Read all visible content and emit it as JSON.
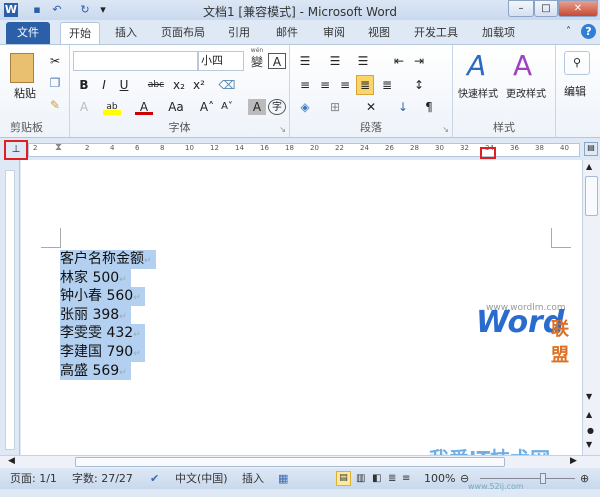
{
  "window": {
    "title": "文档1 [兼容模式] - Microsoft Word",
    "app_icon": "W"
  },
  "tabs": [
    {
      "label": "文件"
    },
    {
      "label": "开始"
    },
    {
      "label": "插入"
    },
    {
      "label": "页面布局"
    },
    {
      "label": "引用"
    },
    {
      "label": "邮件"
    },
    {
      "label": "审阅"
    },
    {
      "label": "视图"
    },
    {
      "label": "开发工具"
    },
    {
      "label": "加载项"
    }
  ],
  "ribbon": {
    "clipboard": {
      "label": "剪贴板",
      "paste": "粘贴"
    },
    "font": {
      "label": "字体",
      "font_name": "",
      "font_size": "小四",
      "bold": "B",
      "italic": "I",
      "underline": "U",
      "strike": "abc",
      "sub": "x₂",
      "sup": "x²",
      "font_color": "A",
      "case": "Aa",
      "grow": "A˄",
      "shrink": "A˅",
      "char_shade": "A",
      "enclose": "字",
      "phonetic": "wén",
      "charborder": "A"
    },
    "paragraph": {
      "label": "段落"
    },
    "styles": {
      "label": "样式",
      "quick": "快速样式",
      "change": "更改样式"
    },
    "editing": {
      "label": "编辑"
    }
  },
  "ruler": {
    "ticks": [
      "2",
      "2",
      "4",
      "6",
      "8",
      "10",
      "12",
      "14",
      "16",
      "18",
      "20",
      "22",
      "24",
      "26",
      "28",
      "30",
      "32",
      "34",
      "36",
      "38",
      "40"
    ]
  },
  "document": {
    "lines": [
      "客户名称金额",
      "林家 500",
      "钟小春 560",
      "张丽 398",
      "李雯雯 432",
      "李建国 790",
      "高盛 569"
    ],
    "para_mark": "↵"
  },
  "watermarks": {
    "url1": "www.wordlm.com",
    "brand1_a": "Word",
    "brand1_b": "联盟",
    "brand2": "我爱IT技术网",
    "url2": "www.52ij.com"
  },
  "status": {
    "page": "页面: 1/1",
    "words": "字数: 27/27",
    "language": "中文(中国)",
    "mode": "插入",
    "zoom": "100%"
  }
}
